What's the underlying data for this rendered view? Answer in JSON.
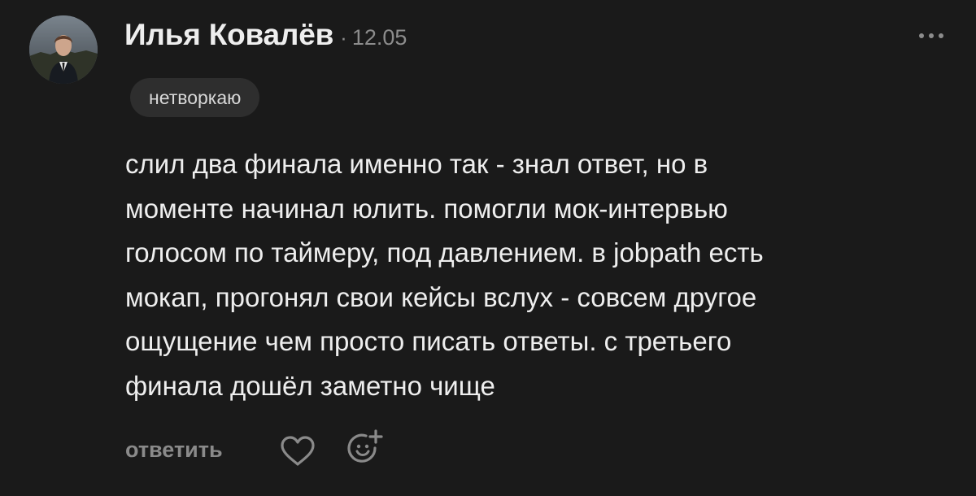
{
  "post": {
    "author": "Илья Ковалёв",
    "separator": "·",
    "date": "12.05",
    "tag": "нетворкаю",
    "text": "слил два финала именно так - знал ответ, но в\nмоменте начинал юлить. помогли мок-интервью\nголосом по таймеру, под давлением. в jobpath есть\nмокап, прогонял свои кейсы вслух - совсем другое\nощущение чем просто писать ответы. с третьего\nфинала дошёл заметно чище"
  },
  "actions": {
    "reply_label": "ответить"
  },
  "icons": {
    "avatar": "avatar-photo",
    "more": "more-horizontal-icon",
    "like": "heart-outline-icon",
    "reaction": "add-reaction-icon"
  },
  "colors": {
    "background": "#1a1a1a",
    "text": "#eeeeee",
    "muted": "#8c8c8c",
    "tag_background": "#2e2e2e"
  }
}
